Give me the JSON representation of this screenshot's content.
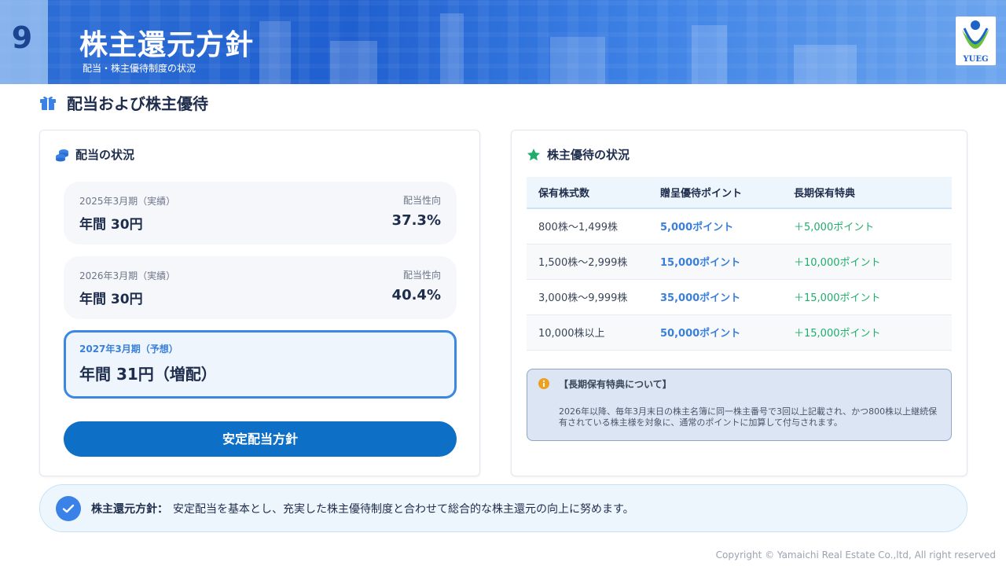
{
  "header": {
    "page_number": "9",
    "title": "株主還元方針",
    "subtitle": "配当・株主優待制度の状況",
    "logo_text": "YUEG"
  },
  "section": {
    "title": "配当および株主優待",
    "icon": "gift-icon"
  },
  "dividends": {
    "title": "配当の状況",
    "icon": "coins-icon",
    "rows": [
      {
        "period": "2025年3月期（実績）",
        "amount": "年間 30円",
        "ratio_label": "配当性向",
        "ratio": "37.3%"
      },
      {
        "period": "2026年3月期（実績）",
        "amount": "年間 30円",
        "ratio_label": "配当性向",
        "ratio": "40.4%"
      }
    ],
    "forecast": {
      "period": "2027年3月期（予想）",
      "amount": "年間 31円（増配）"
    },
    "button_label": "安定配当方針"
  },
  "benefits": {
    "title": "株主優待の状況",
    "icon": "star-icon",
    "columns": [
      "保有株式数",
      "贈呈優待ポイント",
      "長期保有特典"
    ],
    "rows": [
      {
        "shares": "800株～1,499株",
        "points": "5,000ポイント",
        "bonus": "＋5,000ポイント"
      },
      {
        "shares": "1,500株～2,999株",
        "points": "15,000ポイント",
        "bonus": "＋10,000ポイント"
      },
      {
        "shares": "3,000株～9,999株",
        "points": "35,000ポイント",
        "bonus": "＋15,000ポイント"
      },
      {
        "shares": "10,000株以上",
        "points": "50,000ポイント",
        "bonus": "＋15,000ポイント"
      }
    ],
    "note_title": "【長期保有特典について】",
    "note_text": "2026年以降、毎年3月末日の株主名簿に同一株主番号で3回以上記載され、かつ800株以上継続保有されている株主様を対象に、通常のポイントに加算して付与されます。"
  },
  "summary": {
    "label": "株主還元方針：",
    "text": "安定配当を基本とし、充実した株主優待制度と合わせて総合的な株主還元の向上に努めます。"
  },
  "footer": {
    "copyright": "Copyright © Yamaichi Real Estate Co.,ltd, All right reserved"
  },
  "colors": {
    "primary": "#0d6fc5",
    "accent_blue": "#3a7fd9",
    "accent_green": "#1fae6a",
    "text_dark": "#1f2d4d"
  }
}
